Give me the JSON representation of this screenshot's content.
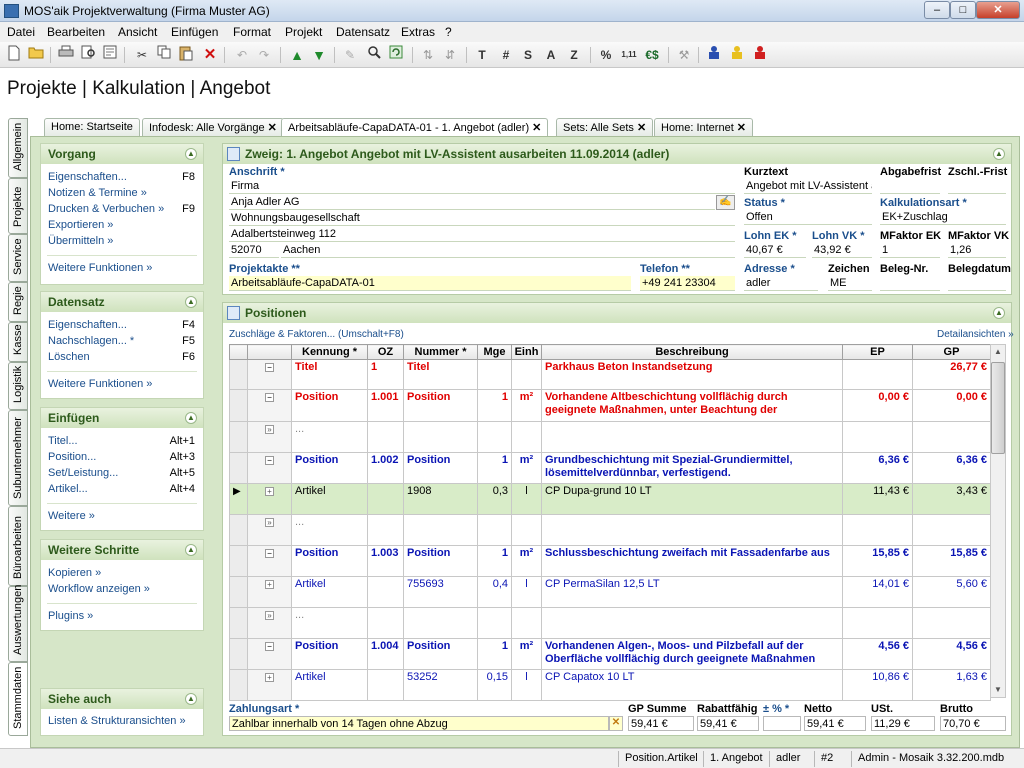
{
  "window": {
    "title": "MOS'aik Projektverwaltung (Firma Muster AG)",
    "min": "–",
    "max": "□",
    "close": "✕"
  },
  "menu": [
    "Datei",
    "Bearbeiten",
    "Ansicht",
    "Einfügen",
    "Format",
    "Projekt",
    "Datensatz",
    "Extras",
    "?"
  ],
  "toolbar": {
    "t": "T",
    "hash": "#",
    "s": "S",
    "a": "A",
    "z": "Z",
    "pct": "%",
    "num": "1,11",
    "euro": "€$"
  },
  "page_title": "Projekte | Kalkulation | Angebot",
  "tabs": [
    {
      "label": "Home: Startseite",
      "close": ""
    },
    {
      "label": "Infodesk: Alle Vorgänge",
      "close": "✕"
    },
    {
      "label": "Arbeitsabläufe-CapaDATA-01 - 1. Angebot (adler)",
      "close": "✕"
    },
    {
      "label": "Sets: Alle Sets",
      "close": "✕"
    },
    {
      "label": "Home: Internet",
      "close": "✕"
    }
  ],
  "vtabs": [
    "Allgemein",
    "Projekte",
    "Service",
    "Regie",
    "Kasse",
    "Logistik",
    "Subunternehmer",
    "Büroarbeiten",
    "Auswertungen",
    "Stammdaten"
  ],
  "panels": {
    "vorgang": {
      "title": "Vorgang",
      "items": [
        {
          "label": "Eigenschaften...",
          "key": "F8"
        },
        {
          "label": "Notizen & Termine »",
          "key": ""
        },
        {
          "label": "Drucken & Verbuchen »",
          "key": "F9"
        },
        {
          "label": "Exportieren »",
          "key": ""
        },
        {
          "label": "Übermitteln »",
          "key": ""
        }
      ],
      "more": "Weitere Funktionen »"
    },
    "datensatz": {
      "title": "Datensatz",
      "items": [
        {
          "label": "Eigenschaften...",
          "key": "F4"
        },
        {
          "label": "Nachschlagen... *",
          "key": "F5"
        },
        {
          "label": "Löschen",
          "key": "F6"
        }
      ],
      "more": "Weitere Funktionen »"
    },
    "einfuegen": {
      "title": "Einfügen",
      "items": [
        {
          "label": "Titel...",
          "key": "Alt+1"
        },
        {
          "label": "Position...",
          "key": "Alt+3"
        },
        {
          "label": "Set/Leistung...",
          "key": "Alt+5"
        },
        {
          "label": "Artikel...",
          "key": "Alt+4"
        }
      ],
      "more": "Weitere »"
    },
    "schritte": {
      "title": "Weitere Schritte",
      "items": [
        {
          "label": "Kopieren »"
        },
        {
          "label": "Workflow anzeigen »"
        }
      ],
      "more": "Plugins »"
    },
    "siehe": {
      "title": "Siehe auch",
      "items": [
        {
          "label": "Listen & Strukturansichten »"
        }
      ]
    }
  },
  "zweig": {
    "title": "Zweig: 1. Angebot Angebot mit LV-Assistent ausarbeiten 11.09.2014 (adler)",
    "anschrift_label": "Anschrift *",
    "anschrift": [
      "Firma",
      "Anja Adler AG",
      "Wohnungsbaugesellschaft",
      "Adalbertsteinweg 112"
    ],
    "plz": "52070",
    "ort": "Aachen",
    "kurztext_label": "Kurztext",
    "kurztext": "Angebot mit LV-Assistent a",
    "abgabefrist_label": "Abgabefrist",
    "abgabefrist": "",
    "zschl_label": "Zschl.-Frist",
    "zschl": "",
    "status_label": "Status *",
    "status": "Offen",
    "kalk_label": "Kalkulationsart *",
    "kalk": "EK+Zuschlag",
    "lohnek_label": "Lohn EK *",
    "lohnek": "40,67 €",
    "lohnvk_label": "Lohn VK *",
    "lohnvk": "43,92 €",
    "mfek_label": "MFaktor EK",
    "mfek": "1",
    "mfvk_label": "MFaktor VK",
    "mfvk": "1,26",
    "projektakte_label": "Projektakte **",
    "projektakte": "Arbeitsabläufe-CapaDATA-01",
    "telefon_label": "Telefon **",
    "telefon": "+49 241 23304",
    "adresse_label": "Adresse *",
    "adresse": "adler",
    "zeichen_label": "Zeichen",
    "zeichen": "ME",
    "belegnr_label": "Beleg-Nr.",
    "belegnr": "",
    "belegdatum_label": "Belegdatum",
    "belegdatum": ""
  },
  "positionen": {
    "title": "Positionen",
    "zuschlaege": "Zuschläge & Faktoren... (Umschalt+F8)",
    "detail": "Detailansichten »",
    "columns": [
      "Kennung *",
      "OZ",
      "Nummer *",
      "Mge",
      "Einh",
      "Beschreibung",
      "EP",
      "GP"
    ],
    "rows": [
      {
        "type": "titel",
        "tree": "−",
        "kennung": "Titel",
        "oz": "1",
        "nummer": "Titel",
        "mge": "",
        "einh": "",
        "beschreibung": "Parkhaus Beton Instandsetzung",
        "ep": "",
        "gp": "26,77 €"
      },
      {
        "type": "posr",
        "tree": "−",
        "kennung": "Position",
        "oz": "1.001",
        "nummer": "Position",
        "mge": "1",
        "einh": "m²",
        "beschreibung": "Vorhandene Altbeschichtung vollflächig durch geeignete Maßnahmen, unter Beachtung der",
        "ep": "0,00 €",
        "gp": "0,00 €"
      },
      {
        "type": "dots",
        "tree": "»",
        "kennung": "...",
        "oz": "",
        "nummer": "",
        "mge": "",
        "einh": "",
        "beschreibung": "",
        "ep": "",
        "gp": ""
      },
      {
        "type": "posb",
        "tree": "−",
        "kennung": "Position",
        "oz": "1.002",
        "nummer": "Position",
        "mge": "1",
        "einh": "m²",
        "beschreibung": "Grundbeschichtung mit Spezial-Grundiermittel, lösemittelverdünnbar, verfestigend.",
        "ep": "6,36 €",
        "gp": "6,36 €"
      },
      {
        "type": "art sel",
        "tree": "+",
        "kennung": "Artikel",
        "oz": "",
        "nummer": "1908",
        "mge": "0,3",
        "einh": "l",
        "beschreibung": "CP Dupa-grund 10 LT",
        "ep": "11,43 €",
        "gp": "3,43 €"
      },
      {
        "type": "dots",
        "tree": "»",
        "kennung": "...",
        "oz": "",
        "nummer": "",
        "mge": "",
        "einh": "",
        "beschreibung": "",
        "ep": "",
        "gp": ""
      },
      {
        "type": "posb",
        "tree": "−",
        "kennung": "Position",
        "oz": "1.003",
        "nummer": "Position",
        "mge": "1",
        "einh": "m²",
        "beschreibung": "Schlussbeschichtung zweifach mit Fassadenfarbe aus",
        "ep": "15,85 €",
        "gp": "15,85 €"
      },
      {
        "type": "art",
        "tree": "+",
        "kennung": "Artikel",
        "oz": "",
        "nummer": "755693",
        "mge": "0,4",
        "einh": "l",
        "beschreibung": "CP PermaSilan 12,5 LT",
        "ep": "14,01 €",
        "gp": "5,60 €"
      },
      {
        "type": "dots",
        "tree": "»",
        "kennung": "...",
        "oz": "",
        "nummer": "",
        "mge": "",
        "einh": "",
        "beschreibung": "",
        "ep": "",
        "gp": ""
      },
      {
        "type": "posb",
        "tree": "−",
        "kennung": "Position",
        "oz": "1.004",
        "nummer": "Position",
        "mge": "1",
        "einh": "m²",
        "beschreibung": "Vorhandenen Algen-, Moos- und Pilzbefall auf der Oberfläche vollflächig durch geeignete Maßnahmen",
        "ep": "4,56 €",
        "gp": "4,56 €"
      },
      {
        "type": "art",
        "tree": "+",
        "kennung": "Artikel",
        "oz": "",
        "nummer": "53252",
        "mge": "0,15",
        "einh": "l",
        "beschreibung": "CP Capatox 10 LT",
        "ep": "10,86 €",
        "gp": "1,63 €"
      }
    ]
  },
  "footer": {
    "zahlungsart_label": "Zahlungsart *",
    "zahlungsart": "Zahlbar innerhalb von 14 Tagen ohne Abzug",
    "gpsumme_label": "GP Summe",
    "gpsumme": "59,41 €",
    "rabatt_label": "Rabattfähig",
    "rabatt": "59,41 €",
    "pct_label": "± % *",
    "pct": "",
    "netto_label": "Netto",
    "netto": "59,41 €",
    "ust_label": "USt.",
    "ust": "11,29 €",
    "brutto_label": "Brutto",
    "brutto": "70,70 €"
  },
  "status": [
    "Position.Artikel",
    "1. Angebot",
    "adler",
    "#2",
    "Admin - Mosaik 3.32.200.mdb"
  ]
}
